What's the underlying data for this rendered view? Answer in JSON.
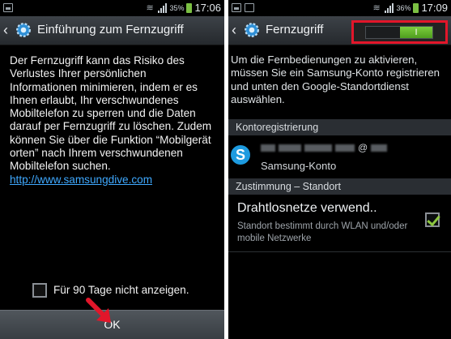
{
  "left_screen": {
    "status_bar": {
      "battery": "35%",
      "time": "17:06"
    },
    "title": "Einführung zum Fernzugriff",
    "body_text": "Der Fernzugriff kann das Risiko des Verlustes Ihrer persönlichen Informationen minimieren, indem er es Ihnen erlaubt, Ihr verschwundenes Mobiltelefon zu sperren und die Daten darauf per Fernzugriff zu löschen. Zudem können Sie über die Funktion “Mobilgerät orten” nach Ihrem verschwundenen Mobiltelefon suchen.",
    "link_text": "http://www.samsungdive.com",
    "dont_show_label": "Für 90 Tage nicht anzeigen.",
    "dont_show_checked": false,
    "ok_label": "OK",
    "arrow_color": "#e2162a"
  },
  "right_screen": {
    "status_bar": {
      "battery": "36%",
      "time": "17:09"
    },
    "title": "Fernzugriff",
    "toggle_label": "I",
    "toggle_on": true,
    "highlight_color": "#e2162a",
    "intro_text": "Um die Fernbedienungen zu aktivieren, müssen Sie ein Samsung-Konto registrieren und unten den Google-Standortdienst auswählen.",
    "section_account": "Kontoregistrierung",
    "account_email_domain": "@",
    "account_type": "Samsung-Konto",
    "section_consent": "Zustimmung – Standort",
    "wlan_title": "Drahtlosnetze verwend..",
    "wlan_desc": "Standort bestimmt durch WLAN und/oder mobile Netzwerke",
    "wlan_checked": true
  },
  "colors": {
    "accent_green": "#7ccd3c",
    "link_blue": "#3fa9ff"
  }
}
